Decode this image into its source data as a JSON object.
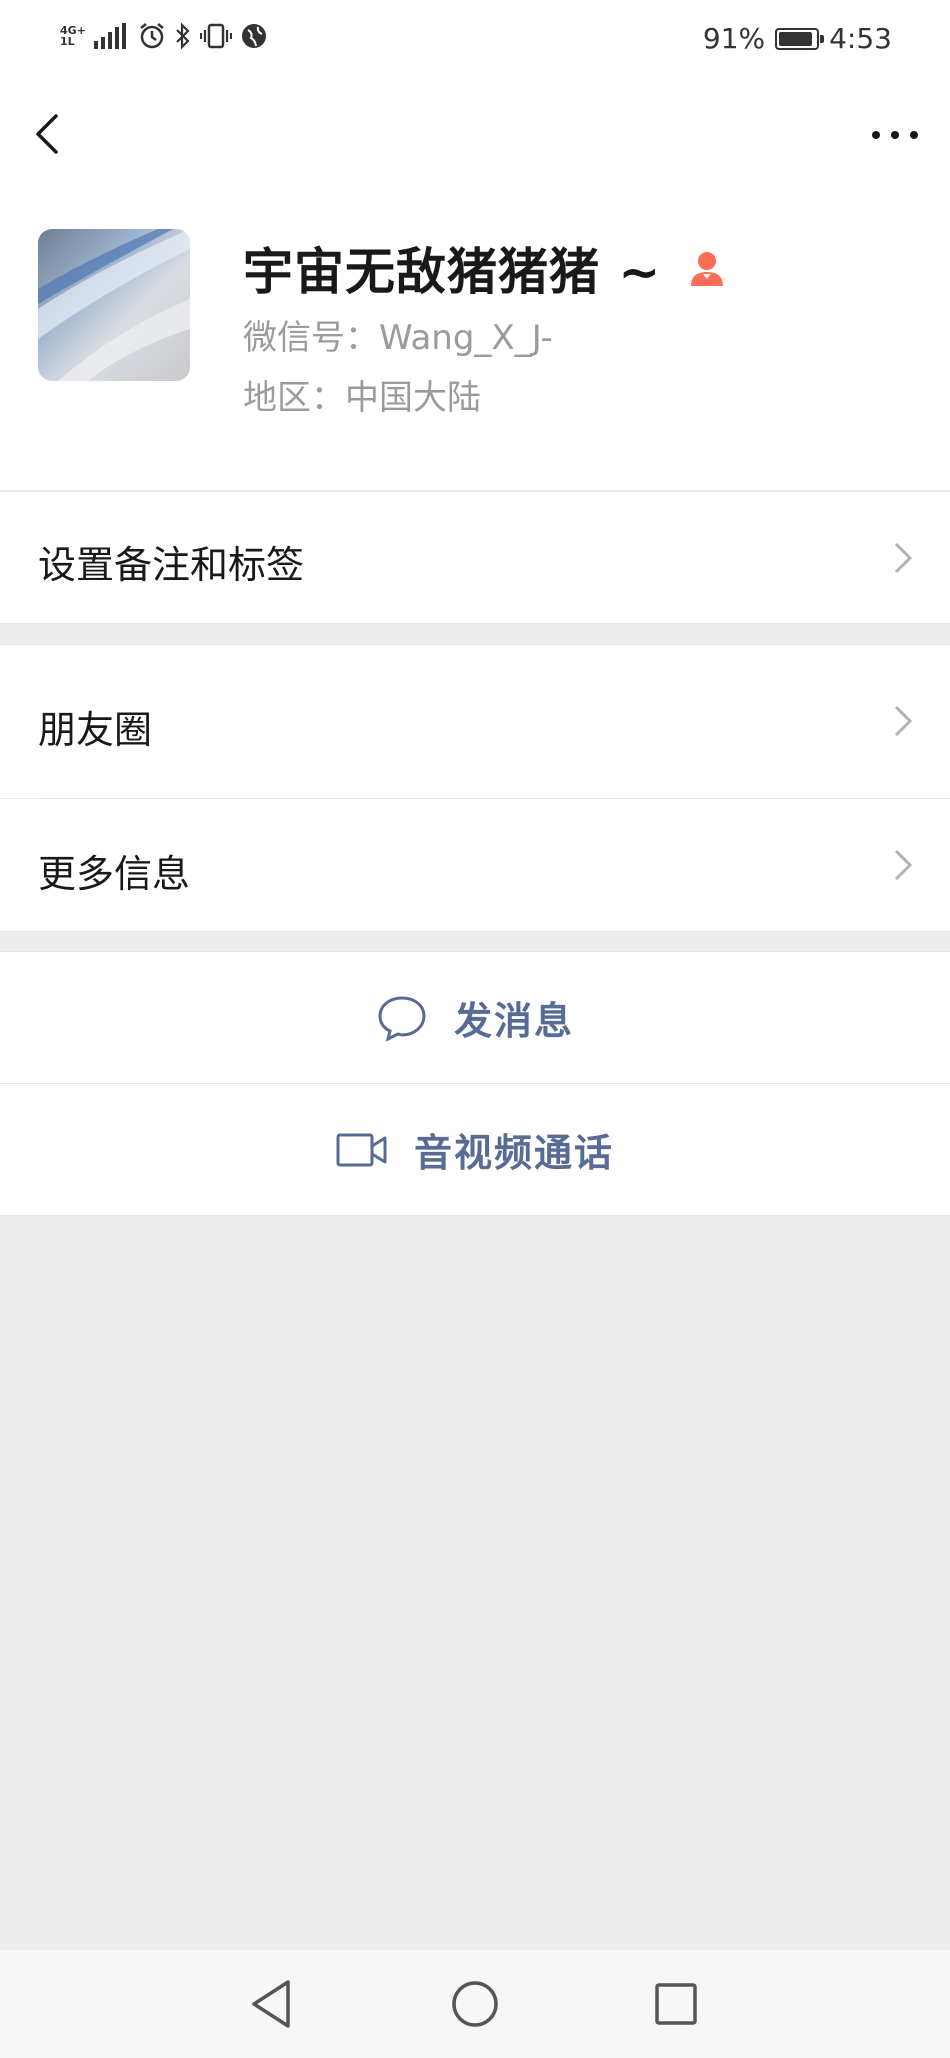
{
  "status_bar": {
    "network_top": "4G+",
    "network_bottom": "1L",
    "battery_percent": "91%",
    "battery_level": 0.91,
    "time": "4:53",
    "icons": [
      "signal-icon",
      "alarm-icon",
      "bluetooth-icon",
      "vibrate-icon",
      "globe-icon",
      "battery-icon"
    ]
  },
  "header": {
    "back_icon": "chevron-left-icon",
    "more_icon": "more-dots-icon"
  },
  "profile": {
    "nickname": "宇宙无敌猪猪猪 ~",
    "gender_icon": "female-user-icon",
    "gender_color": "#fa6d58",
    "wechat_id": "微信号：Wang_X_J-",
    "region": "地区：中国大陆"
  },
  "menu": {
    "remark_tags": "设置备注和标签",
    "moments": "朋友圈",
    "more_info": "更多信息"
  },
  "actions": {
    "send_message": "发消息",
    "video_call": "音视频通话",
    "accent_color": "#576b95"
  },
  "system_nav": {
    "back": "triangle-back-icon",
    "home": "circle-home-icon",
    "recent": "square-recent-icon"
  }
}
